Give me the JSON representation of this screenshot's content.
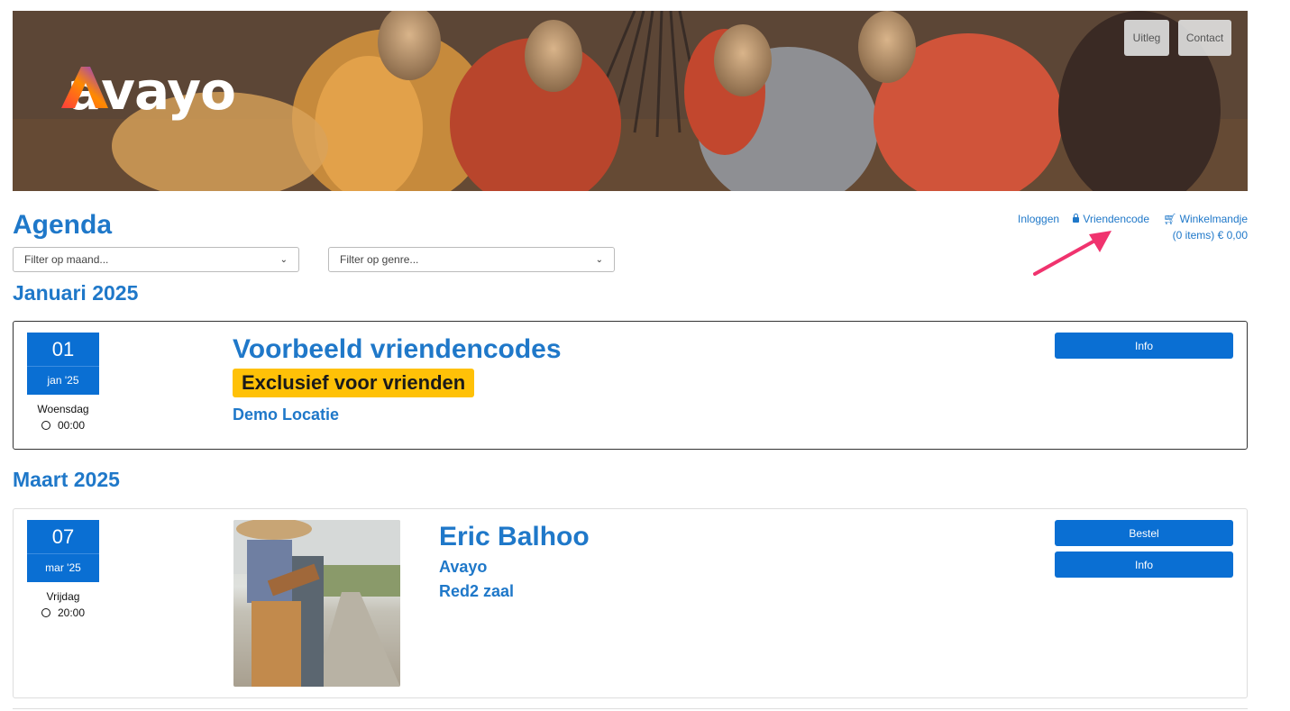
{
  "brand": {
    "name": "avayo"
  },
  "header_buttons": [
    {
      "label": "Uitleg"
    },
    {
      "label": "Contact"
    }
  ],
  "page_title": "Agenda",
  "topnav": {
    "login": "Inloggen",
    "friendcode": "Vriendencode",
    "cart": "Winkelmandje",
    "cart_summary": "(0 items) € 0,00"
  },
  "filters": {
    "month": "Filter op maand...",
    "genre": "Filter op genre..."
  },
  "sections": [
    {
      "month": "Januari 2025",
      "event": {
        "day": "01",
        "month_short": "jan '25",
        "weekday": "Woensdag",
        "time": "00:00",
        "title": "Voorbeeld vriendencodes",
        "badge": "Exclusief voor vrienden",
        "location": "Demo Locatie",
        "buttons": [
          "Info"
        ]
      }
    },
    {
      "month": "Maart 2025",
      "event": {
        "day": "07",
        "month_short": "mar '25",
        "weekday": "Vrijdag",
        "time": "20:00",
        "title": "Eric Balhoo",
        "organizer": "Avayo",
        "venue": "Red2 zaal",
        "buttons": [
          "Bestel",
          "Info"
        ]
      }
    }
  ],
  "colors": {
    "link": "#1f78c9",
    "button": "#0a6fd3",
    "badge": "#ffc107",
    "annotation_arrow": "#f0336e"
  }
}
